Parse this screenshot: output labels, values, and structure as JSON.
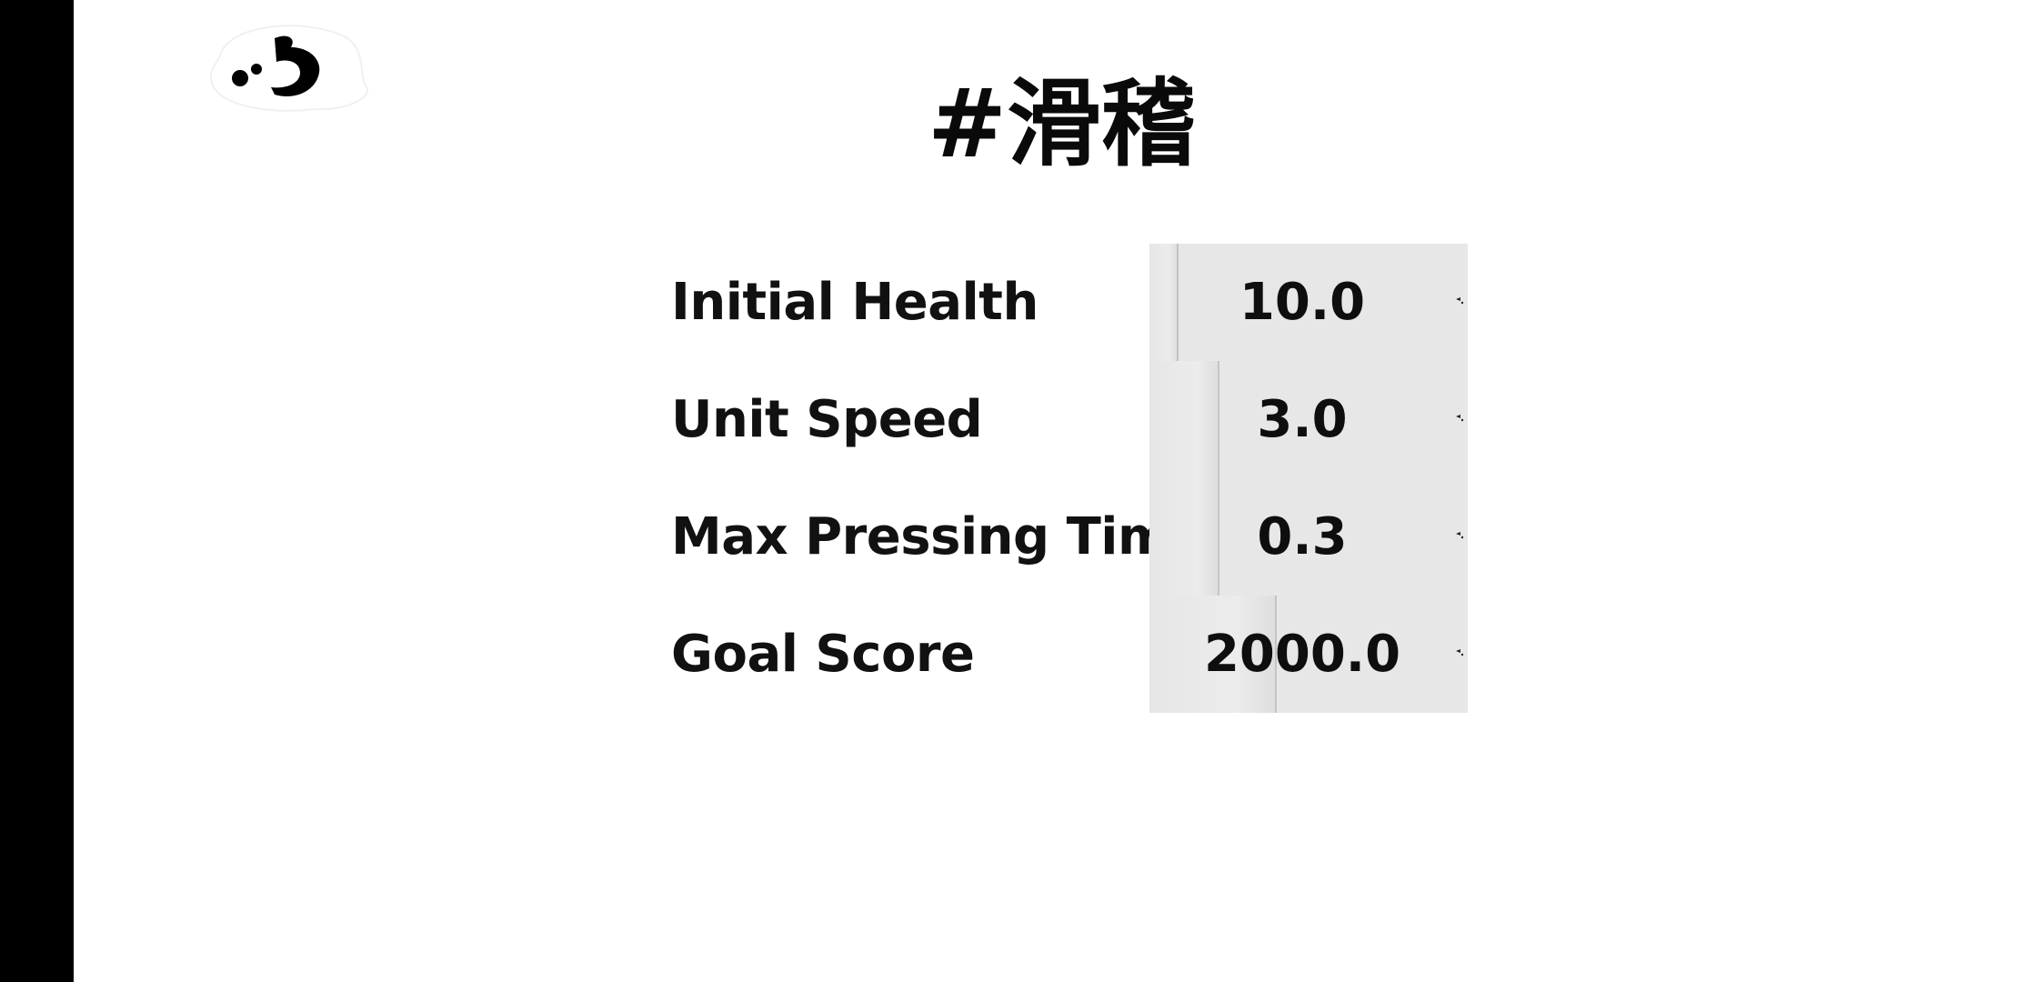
{
  "title": "#滑稽",
  "settings": [
    {
      "label": "Initial Health",
      "value": "10.0",
      "fill": 0.09
    },
    {
      "label": "Unit Speed",
      "value": "3.0",
      "fill": 0.22
    },
    {
      "label": "Max Pressing Time",
      "value": "0.3",
      "fill": 0.22
    },
    {
      "label": "Goal Score",
      "value": "2000.0",
      "fill": 0.4
    }
  ],
  "icons": {
    "logo": "swirl-logo-icon",
    "slider_arrow": "small-arrow-icon"
  },
  "colors": {
    "background": "#ffffff",
    "side_bar": "#000000",
    "slider_bg": "#e7e7e7",
    "text": "#111111"
  }
}
